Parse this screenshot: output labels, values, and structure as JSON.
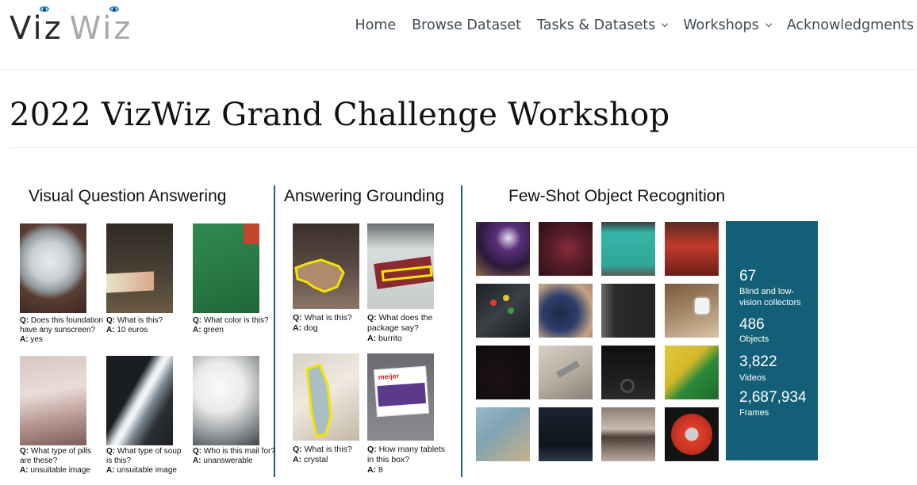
{
  "brand": {
    "part1": "Viz",
    "part2": "Wiz"
  },
  "nav": {
    "items": [
      {
        "label": "Home"
      },
      {
        "label": "Browse Dataset"
      },
      {
        "label": "Tasks & Datasets"
      },
      {
        "label": "Workshops"
      },
      {
        "label": "Acknowledgments"
      }
    ]
  },
  "page": {
    "title": "2022 VizWiz Grand Challenge Workshop"
  },
  "banner": {
    "vqa": {
      "title": "Visual Question Answering",
      "items": [
        {
          "q": "Does this foundation have any sunscreen?",
          "a": "yes"
        },
        {
          "q": "What is this?",
          "a": "10 euros"
        },
        {
          "q": "What color is this?",
          "a": "green"
        },
        {
          "q": "What type of pills are these?",
          "a": "unsuitable image"
        },
        {
          "q": "What type of soup is this?",
          "a": "unsuitable image"
        },
        {
          "q": "Who is this mail for?",
          "a": "unanswerable"
        }
      ]
    },
    "grounding": {
      "title": "Answering Grounding",
      "items": [
        {
          "q": "What is this?",
          "a": "dog"
        },
        {
          "q": "What does the package say?",
          "a": "burrito"
        },
        {
          "q": "What is this?",
          "a": "crystal"
        },
        {
          "q": "How many tablets in this box?",
          "a": "8"
        }
      ],
      "package_text": "meijer"
    },
    "fewshot": {
      "title": "Few-Shot Object Recognition",
      "stats": [
        {
          "value": "67",
          "label": "Blind and low-vision collectors"
        },
        {
          "value": "486",
          "label": "Objects"
        },
        {
          "value": "3,822",
          "label": "Videos"
        },
        {
          "value": "2,687,934",
          "label": "Frames"
        }
      ]
    },
    "q_prefix": "Q:",
    "a_prefix": "A:",
    "colors": {
      "divider": "#1b5f74",
      "stats_bg": "#125f77",
      "highlight": "#f2e600"
    }
  }
}
